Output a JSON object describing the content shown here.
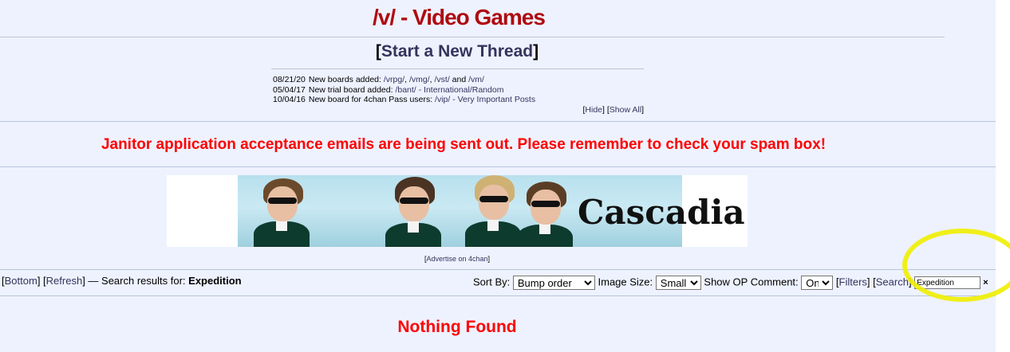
{
  "board": {
    "title": "/v/ - Video Games"
  },
  "new_thread": {
    "open": "[",
    "label": "Start a New Thread",
    "close": "]"
  },
  "news": [
    {
      "date": "08/21/20",
      "text": "New boards added:",
      "links": [
        "/vrpg/",
        "/vmg/",
        "/vst/",
        "/vm/"
      ],
      "seps": [
        ", ",
        ", ",
        " and ",
        ""
      ]
    },
    {
      "date": "05/04/17",
      "text": "New trial board added:",
      "link": "/bant/ - International/Random"
    },
    {
      "date": "10/04/16",
      "text": "New board for 4chan Pass users:",
      "link": "/vip/ - Very Important Posts"
    }
  ],
  "news_controls": {
    "hide": "Hide",
    "show_all": "Show All"
  },
  "announcement": "Janitor application acceptance emails are being sent out. Please remember to check your spam box!",
  "banner": {
    "text": "Cascadia"
  },
  "advertise": "Advertise on 4chan",
  "controls": {
    "bottom": "Bottom",
    "refresh": "Refresh",
    "search_results_label": "— Search results for:",
    "query": "Expedition",
    "sort_by_label": "Sort By:",
    "sort_by_value": "Bump order",
    "image_size_label": "Image Size:",
    "image_size_value": "Small",
    "show_op_label": "Show OP Comment:",
    "show_op_value": "On",
    "filters": "Filters",
    "search": "Search",
    "search_value": "Expedition",
    "clear": "×"
  },
  "result": "Nothing Found",
  "colors": {
    "title": "#af0a0f",
    "link": "#34345c",
    "alert": "#ff0000",
    "bg": "#eef2ff",
    "highlight": "#f0ee00"
  }
}
